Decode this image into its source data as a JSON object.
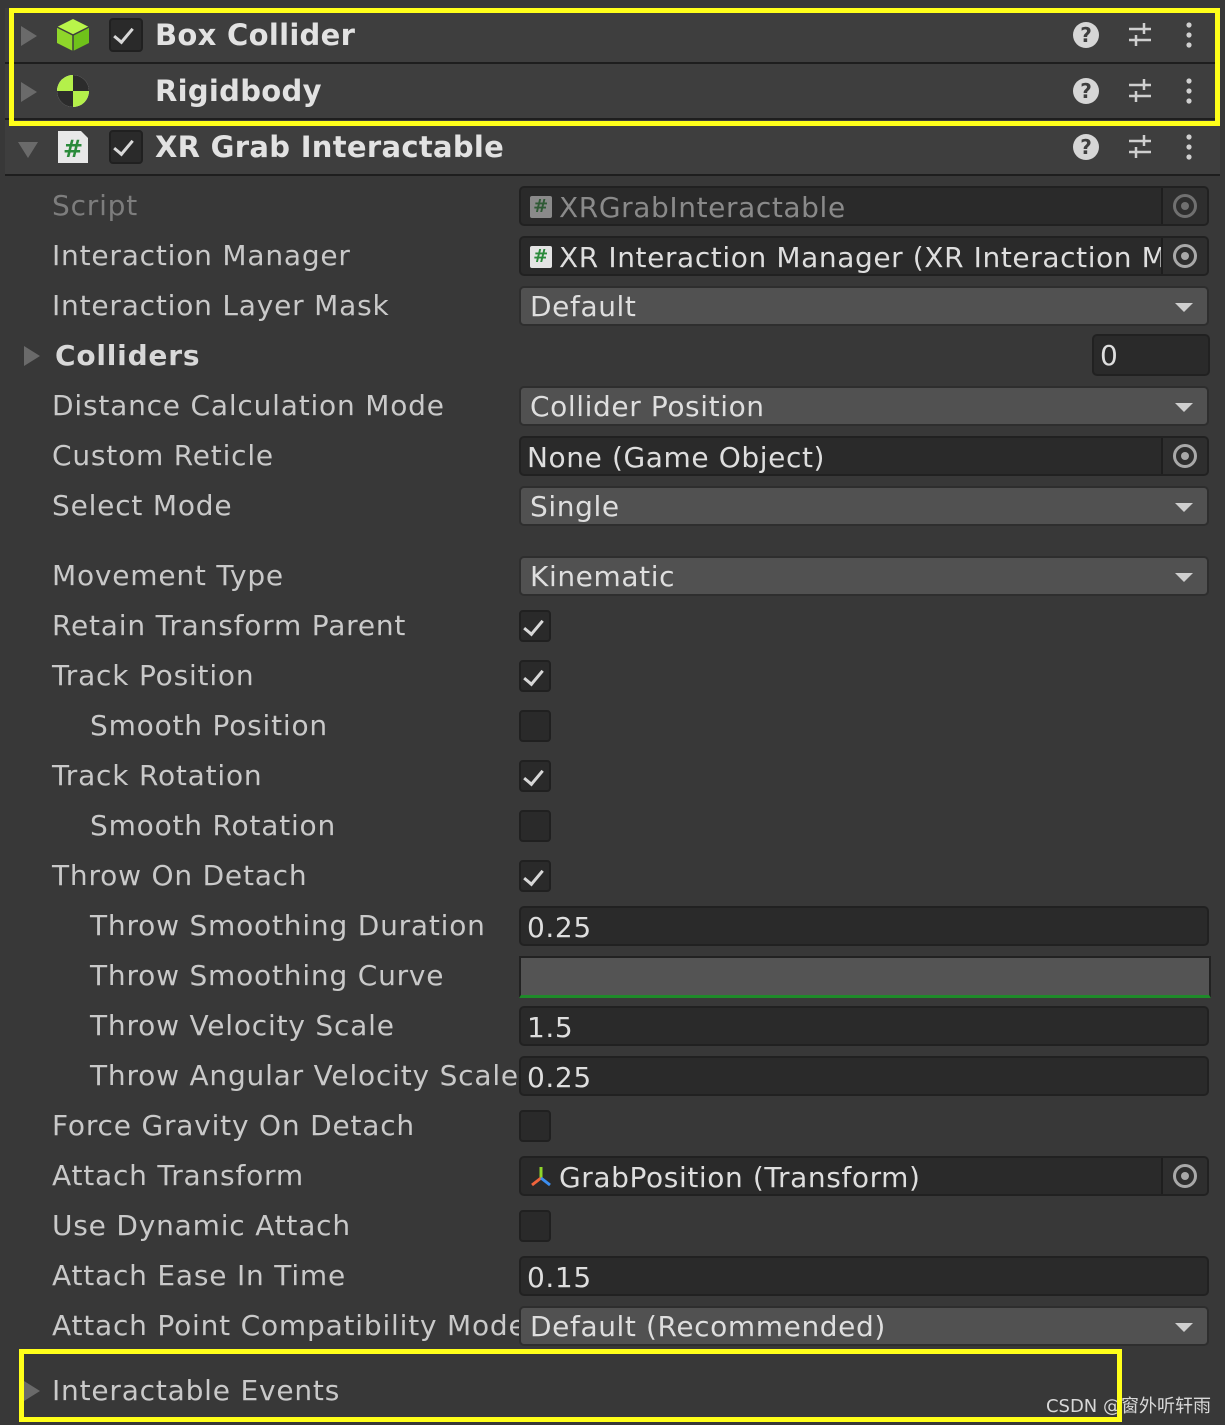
{
  "components": [
    {
      "title": "Box Collider",
      "enabled": true,
      "expanded": false,
      "icon": "box-collider-icon"
    },
    {
      "title": "Rigidbody",
      "expanded": false,
      "icon": "rigidbody-icon"
    },
    {
      "title": "XR Grab Interactable",
      "enabled": true,
      "expanded": true,
      "icon": "script-icon"
    }
  ],
  "header_buttons": {
    "help": "?"
  },
  "properties": {
    "script": {
      "label": "Script",
      "value": "XRGrabInteractable"
    },
    "interaction_manager": {
      "label": "Interaction Manager",
      "value": "XR Interaction Manager (XR Interaction Ma"
    },
    "interaction_layer_mask": {
      "label": "Interaction Layer Mask",
      "value": "Default"
    },
    "colliders": {
      "label": "Colliders",
      "count": "0"
    },
    "distance_calculation_mode": {
      "label": "Distance Calculation Mode",
      "value": "Collider Position"
    },
    "custom_reticle": {
      "label": "Custom Reticle",
      "value": "None (Game Object)"
    },
    "select_mode": {
      "label": "Select Mode",
      "value": "Single"
    },
    "movement_type": {
      "label": "Movement Type",
      "value": "Kinematic"
    },
    "retain_transform_parent": {
      "label": "Retain Transform Parent",
      "checked": true
    },
    "track_position": {
      "label": "Track Position",
      "checked": true
    },
    "smooth_position": {
      "label": "Smooth Position",
      "checked": false
    },
    "track_rotation": {
      "label": "Track Rotation",
      "checked": true
    },
    "smooth_rotation": {
      "label": "Smooth Rotation",
      "checked": false
    },
    "throw_on_detach": {
      "label": "Throw On Detach",
      "checked": true
    },
    "throw_smoothing_duration": {
      "label": "Throw Smoothing Duration",
      "value": "0.25"
    },
    "throw_smoothing_curve": {
      "label": "Throw Smoothing Curve"
    },
    "throw_velocity_scale": {
      "label": "Throw Velocity Scale",
      "value": "1.5"
    },
    "throw_angular_velocity_scale": {
      "label": "Throw Angular Velocity Scale",
      "value": "0.25"
    },
    "force_gravity_on_detach": {
      "label": "Force Gravity On Detach",
      "checked": false
    },
    "attach_transform": {
      "label": "Attach Transform",
      "value": "GrabPosition (Transform)"
    },
    "use_dynamic_attach": {
      "label": "Use Dynamic Attach",
      "checked": false
    },
    "attach_ease_in_time": {
      "label": "Attach Ease In Time",
      "value": "0.15"
    },
    "attach_point_compatibility_mode": {
      "label": "Attach Point Compatibility Mode",
      "value": "Default (Recommended)"
    },
    "interactable_events": {
      "label": "Interactable Events"
    }
  },
  "watermark": "CSDN @窗外听轩雨",
  "colors": {
    "highlight": "#ffff1a",
    "background": "#383838",
    "accent_green": "#1f8a2a"
  }
}
